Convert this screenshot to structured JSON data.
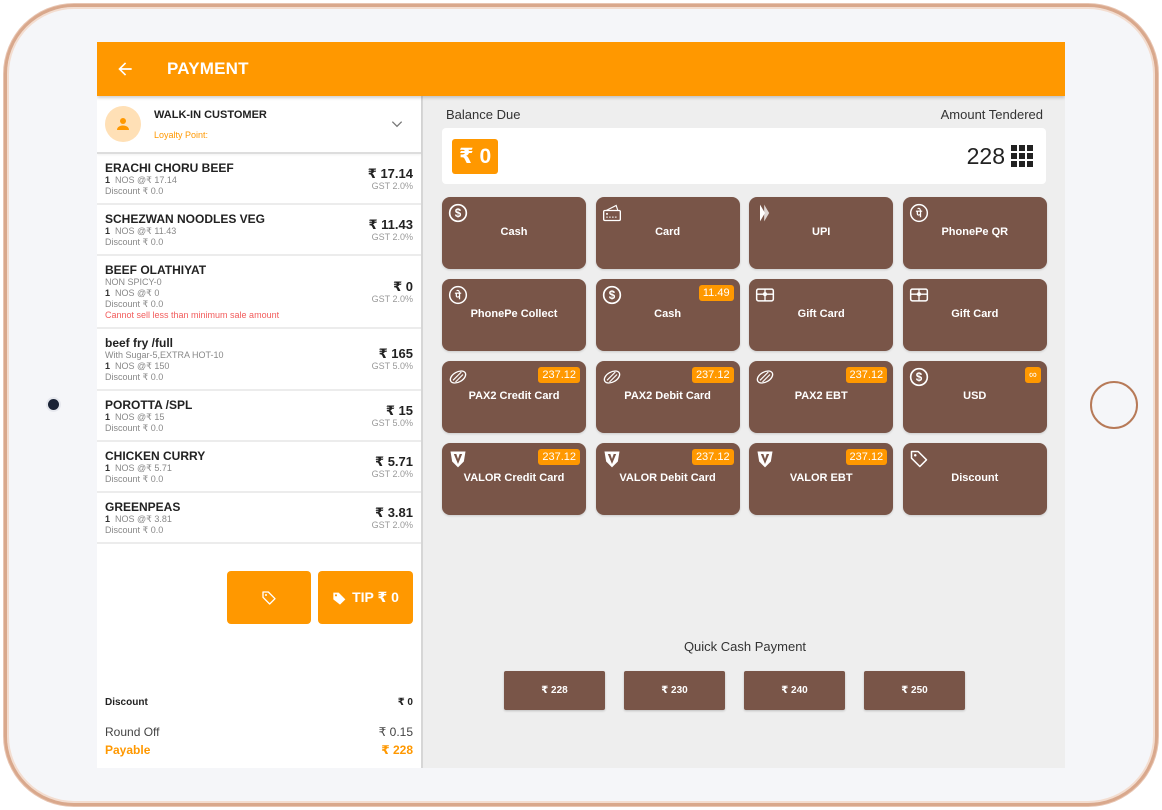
{
  "header": {
    "title": "PAYMENT"
  },
  "customer": {
    "name": "WALK-IN CUSTOMER",
    "loyalty_label": "Loyalty Point:"
  },
  "items": [
    {
      "name": "ERACHI CHORU BEEF",
      "note": "",
      "qty": "1",
      "qty_text": "NOS @₹ 17.14",
      "discount": "Discount ₹ 0.0",
      "error": "",
      "price": "₹ 17.14",
      "gst": "GST 2.0%"
    },
    {
      "name": "SCHEZWAN NOODLES VEG",
      "note": "",
      "qty": "1",
      "qty_text": "NOS @₹ 11.43",
      "discount": "Discount ₹ 0.0",
      "error": "",
      "price": "₹ 11.43",
      "gst": "GST 2.0%"
    },
    {
      "name": "BEEF OLATHIYAT",
      "note": "NON SPICY-0",
      "qty": "1",
      "qty_text": "NOS @₹ 0",
      "discount": "Discount ₹ 0.0",
      "error": "Cannot sell less than minimum sale amount",
      "price": "₹ 0",
      "gst": "GST 2.0%"
    },
    {
      "name": "beef fry /full",
      "note": "With Sugar-5,EXTRA HOT-10",
      "qty": "1",
      "qty_text": "NOS @₹ 150",
      "discount": "Discount ₹ 0.0",
      "error": "",
      "price": "₹ 165",
      "gst": "GST 5.0%"
    },
    {
      "name": "POROTTA /SPL",
      "note": "",
      "qty": "1",
      "qty_text": "NOS @₹ 15",
      "discount": "Discount ₹ 0.0",
      "error": "",
      "price": "₹ 15",
      "gst": "GST 5.0%"
    },
    {
      "name": "CHICKEN CURRY",
      "note": "",
      "qty": "1",
      "qty_text": "NOS @₹ 5.71",
      "discount": "Discount ₹ 0.0",
      "error": "",
      "price": "₹ 5.71",
      "gst": "GST 2.0%"
    },
    {
      "name": "GREENPEAS",
      "note": "",
      "qty": "1",
      "qty_text": "NOS @₹ 3.81",
      "discount": "Discount ₹ 0.0",
      "error": "",
      "price": "₹ 3.81",
      "gst": "GST 2.0%"
    }
  ],
  "actions": {
    "tip_label": "TIP ₹ 0"
  },
  "totals": {
    "discount_label": "Discount",
    "discount_value": "₹ 0",
    "roundoff_label": "Round Off",
    "roundoff_value": "₹ 0.15",
    "payable_label": "Payable",
    "payable_value": "₹ 228"
  },
  "balance": {
    "due_label": "Balance Due",
    "tendered_label": "Amount Tendered",
    "due_value": "₹ 0",
    "tendered_value": "228"
  },
  "methods": [
    {
      "label": "Cash",
      "icon": "dollar-circle-icon",
      "badge": ""
    },
    {
      "label": "Card",
      "icon": "card-icon",
      "badge": ""
    },
    {
      "label": "UPI",
      "icon": "upi-icon",
      "badge": ""
    },
    {
      "label": "PhonePe QR",
      "icon": "phonepe-icon",
      "badge": ""
    },
    {
      "label": "PhonePe Collect",
      "icon": "phonepe-icon",
      "badge": ""
    },
    {
      "label": "Cash",
      "icon": "dollar-circle-icon",
      "badge": "11.49"
    },
    {
      "label": "Gift Card",
      "icon": "gift-card-icon",
      "badge": ""
    },
    {
      "label": "Gift Card",
      "icon": "gift-card-icon",
      "badge": ""
    },
    {
      "label": "PAX2 Credit Card",
      "icon": "pax-icon",
      "badge": "237.12"
    },
    {
      "label": "PAX2 Debit Card",
      "icon": "pax-icon",
      "badge": "237.12"
    },
    {
      "label": "PAX2 EBT",
      "icon": "pax-icon",
      "badge": "237.12"
    },
    {
      "label": "USD",
      "icon": "dollar-circle-icon",
      "badge": "∞"
    },
    {
      "label": "VALOR Credit Card",
      "icon": "valor-icon",
      "badge": "237.12"
    },
    {
      "label": "VALOR Debit Card",
      "icon": "valor-icon",
      "badge": "237.12"
    },
    {
      "label": "VALOR EBT",
      "icon": "valor-icon",
      "badge": "237.12"
    },
    {
      "label": "Discount",
      "icon": "tag-icon",
      "badge": ""
    }
  ],
  "quick_cash": {
    "title": "Quick Cash Payment",
    "amounts": [
      "₹ 228",
      "₹ 230",
      "₹ 240",
      "₹ 250"
    ]
  },
  "colors": {
    "accent": "#ff9800",
    "method_tile": "#795548",
    "error": "#f25c5c"
  }
}
